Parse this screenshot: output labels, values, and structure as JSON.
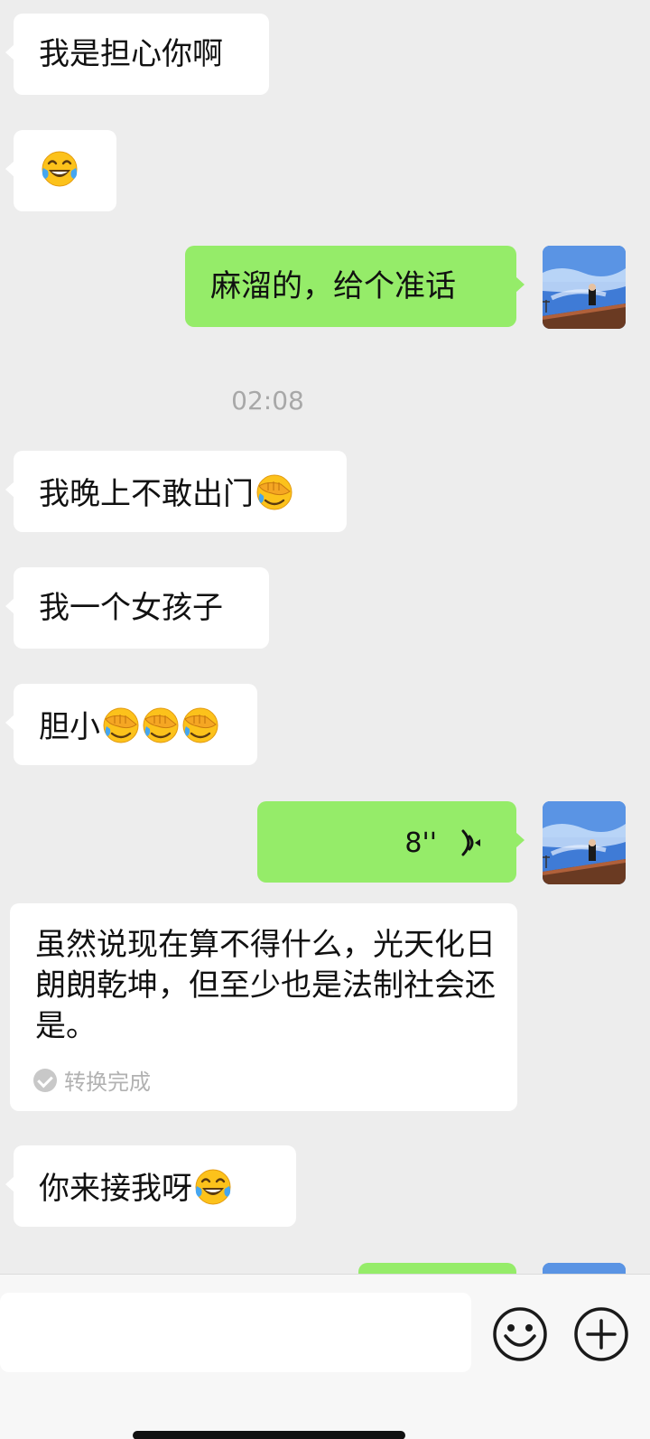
{
  "messages": {
    "m1": {
      "text": "我是担心你啊"
    },
    "m2": {
      "emoji": "tears-of-joy"
    },
    "m3": {
      "text": "麻溜的，给个准话"
    },
    "time": "02:08",
    "m4": {
      "text": "我晚上不敢出门",
      "emoji": "facepalm"
    },
    "m5": {
      "text": "我一个女孩子"
    },
    "m6": {
      "text": "胆小",
      "emoji": "facepalm"
    },
    "voice": {
      "duration": "8''"
    },
    "transcript": {
      "text": "虽然说现在算不得什么，光天化日朗朗乾坤，但至少也是法制社会还是。",
      "status": "转换完成"
    },
    "m7": {
      "text": "你来接我呀",
      "emoji": "tears-of-joy"
    }
  },
  "input": {
    "value": ""
  },
  "colors": {
    "incoming": "#ffffff",
    "outgoing": "#95ec69",
    "background": "#ededed"
  }
}
